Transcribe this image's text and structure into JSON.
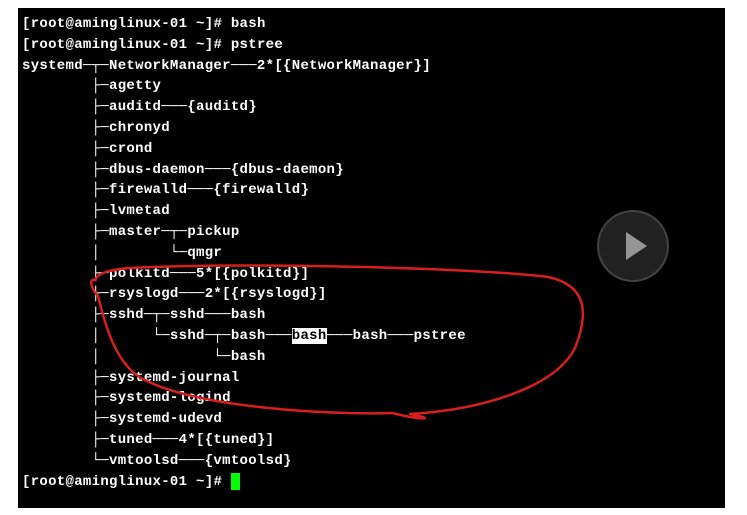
{
  "prompt": {
    "open": "[",
    "user": "root",
    "at": "@",
    "host": "aminglinux-01",
    "space": " ",
    "path": "~",
    "close": "]#",
    "cmd1": " bash",
    "cmd2": " pstree",
    "cmd3": " "
  },
  "tree": {
    "l0": "systemd─┬─NetworkManager───2*[{NetworkManager}]",
    "l1": "        ├─agetty",
    "l2": "        ├─auditd───{auditd}",
    "l3": "        ├─chronyd",
    "l4": "        ├─crond",
    "l5": "        ├─dbus-daemon───{dbus-daemon}",
    "l6": "        ├─firewalld───{firewalld}",
    "l7": "        ├─lvmetad",
    "l8": "        ├─master─┬─pickup",
    "l9": "        │        └─qmgr",
    "l10": "        ├─polkitd───5*[{polkitd}]",
    "l11": "        ├─rsyslogd───2*[{rsyslogd}]",
    "l12": "        ├─sshd─┬─sshd───bash",
    "l13a": "        │      └─sshd─┬─bash───",
    "l13h": "bash",
    "l13b": "───bash───pstree",
    "l14": "        │             └─bash",
    "l15": "        ├─systemd-journal",
    "l16": "        ├─systemd-logind",
    "l17": "        ├─systemd-udevd",
    "l18": "        ├─tuned───4*[{tuned}]",
    "l19": "        └─vmtoolsd───{vmtoolsd}"
  }
}
